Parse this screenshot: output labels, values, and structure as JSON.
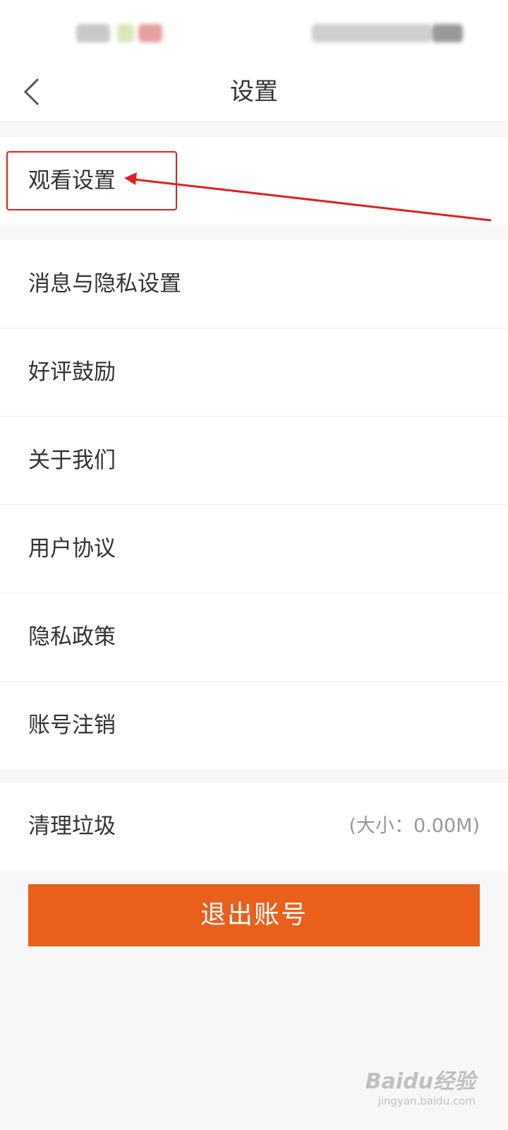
{
  "header": {
    "title": "设置"
  },
  "settings": {
    "group1": [
      {
        "id": "watch-settings",
        "label": "观看设置"
      }
    ],
    "group2": [
      {
        "id": "message-privacy-settings",
        "label": "消息与隐私设置"
      },
      {
        "id": "good-review",
        "label": "好评鼓励"
      },
      {
        "id": "about-us",
        "label": "关于我们"
      },
      {
        "id": "user-agreement",
        "label": "用户协议"
      },
      {
        "id": "privacy-policy",
        "label": "隐私政策"
      },
      {
        "id": "account-cancellation",
        "label": "账号注销"
      }
    ],
    "group3": [
      {
        "id": "clear-cache",
        "label": "清理垃圾",
        "value": "(大小：0.00M)"
      }
    ]
  },
  "logout": {
    "label": "退出账号"
  },
  "watermark": {
    "main": "Baidu经验",
    "sub": "jingyan.baidu.com"
  },
  "colors": {
    "accent": "#e9601d",
    "annotation": "#e02020",
    "background": "#f7f7f7"
  },
  "icons": {
    "back": "chevron-left-icon"
  }
}
